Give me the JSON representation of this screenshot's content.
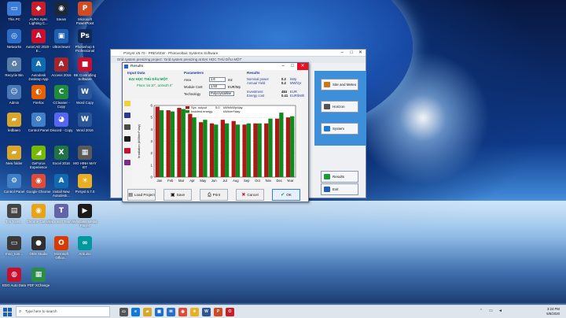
{
  "desktop": {
    "icons": [
      {
        "label": "This PC",
        "glyph": "▭",
        "color": "#3b7dd8"
      },
      {
        "label": "AURA Sync Lighting C...",
        "glyph": "◆",
        "color": "#c81e2a"
      },
      {
        "label": "Steam",
        "glyph": "◉",
        "color": "#1b2838"
      },
      {
        "label": "Microsoft PowerPoint",
        "glyph": "P",
        "color": "#d04a22"
      },
      {
        "label": "Networks",
        "glyph": "◎",
        "color": "#2b6cc8"
      },
      {
        "label": "AutoCAD 2020 - E...",
        "glyph": "A",
        "color": "#c8102e"
      },
      {
        "label": "UltraViewer",
        "glyph": "▣",
        "color": "#1f5fb0"
      },
      {
        "label": "Photoshop 5 Professional",
        "glyph": "Ps",
        "color": "#102a55"
      },
      {
        "label": "Recycle Bin",
        "glyph": "♻",
        "color": "#5a7da8"
      },
      {
        "label": "Autodesk Desktop App",
        "glyph": "A",
        "color": "#0f6ab0"
      },
      {
        "label": "Access 2016",
        "glyph": "A",
        "color": "#a4262c"
      },
      {
        "label": "BK Controlling Software",
        "glyph": "■",
        "color": "#c8102e"
      },
      {
        "label": "Admin",
        "glyph": "☺",
        "color": "#4a78b8"
      },
      {
        "label": "Firefox",
        "glyph": "◐",
        "color": "#e66000"
      },
      {
        "label": "CCleaner - Copy",
        "glyph": "C",
        "color": "#1e8c3a"
      },
      {
        "label": "Word Copy",
        "glyph": "W",
        "color": "#2b579a"
      },
      {
        "label": "ledbaeo",
        "glyph": "▰",
        "color": "#d8a62a"
      },
      {
        "label": "Control Panel",
        "glyph": "⚙",
        "color": "#3f7fc8"
      },
      {
        "label": "Discord - Copy",
        "glyph": "◕",
        "color": "#5865f2"
      },
      {
        "label": "Word 2016",
        "glyph": "W",
        "color": "#2b579a"
      },
      {
        "label": "New folder",
        "glyph": "▰",
        "color": "#d8a62a"
      },
      {
        "label": "GeForce Experience",
        "glyph": "◢",
        "color": "#76b900"
      },
      {
        "label": "Excel 2016",
        "glyph": "X",
        "color": "#217346"
      },
      {
        "label": "MO HINH MAY ĐT",
        "glyph": "▦",
        "color": "#5a5a5a"
      },
      {
        "label": "Control Panel",
        "glyph": "⚙",
        "color": "#3f7fc8"
      },
      {
        "label": "Google Chrome",
        "glyph": "◉",
        "color": "#dd4b39"
      },
      {
        "label": "Install New Autodesk...",
        "glyph": "A",
        "color": "#0f6ab0"
      },
      {
        "label": "PVsyst 6.7.0",
        "glyph": "☀",
        "color": "#e8b020"
      },
      {
        "label": "Toll Tools...",
        "glyph": "▤",
        "color": "#444"
      },
      {
        "label": "Chrome Canary",
        "glyph": "◉",
        "color": "#e8a317"
      },
      {
        "label": "Microsoft Teams",
        "glyph": "T",
        "color": "#6264a7"
      },
      {
        "label": "Windows Media Player",
        "glyph": "▶",
        "color": "#1a1a1a"
      },
      {
        "label": "moo_tom...",
        "glyph": "▭",
        "color": "#3a3a3a"
      },
      {
        "label": "OBS Studio",
        "glyph": "●",
        "color": "#302e31"
      },
      {
        "label": "Microsoft Office...",
        "glyph": "O",
        "color": "#d83b01"
      },
      {
        "label": "Arduino",
        "glyph": "∞",
        "color": "#00979d"
      },
      {
        "label": "EDG Auto Data",
        "glyph": "◍",
        "color": "#c8102e"
      },
      {
        "label": "PDF XChange",
        "glyph": "▦",
        "color": "#2a8c4a"
      }
    ]
  },
  "main_window": {
    "title": "PVsyst V6.70 - PREVIEW - Photovoltaic Systems Software",
    "subtitle": "Grid system presizing project: 'Grid system presizing  at ĐẠI HỌC THỦ DẦU MỘT'",
    "side_buttons": [
      {
        "label": "Site and Meteo",
        "icon_color": "#c87a1a"
      },
      {
        "label": "Horizon",
        "icon_color": "#555"
      },
      {
        "label": "System",
        "icon_color": "#1e7ad0"
      },
      {
        "label": "Results",
        "icon_color": "#1a9a3a"
      },
      {
        "label": "Exit",
        "icon_color": "#1e5fb8"
      }
    ]
  },
  "dialog": {
    "title": "Results",
    "input_data": {
      "heading": "Input Data",
      "project_name": "ĐẠI HỌC THỦ DẦU MỘT",
      "place": "Place: lat 10°, azimuth 0°"
    },
    "parameters": {
      "heading": "Parameters",
      "rows": [
        {
          "label": "Area",
          "value": "1.6",
          "unit": "m2"
        },
        {
          "label": "Module Cost",
          "value": "1.50",
          "unit": "EUR/Wp"
        },
        {
          "label": "Technology",
          "value": "Polycrystalline",
          "unit": ""
        }
      ]
    },
    "results": {
      "heading": "Results",
      "rows": [
        {
          "label": "Nominal power",
          "value": "0.2",
          "unit": "kWp"
        },
        {
          "label": "Annual Yield",
          "value": "0.2",
          "unit": "MWh/yr"
        },
        {
          "label": "Investment",
          "value": "484",
          "unit": "EUR"
        },
        {
          "label": "Energy cost",
          "value": "0.41",
          "unit": "EUR/kWh"
        }
      ]
    },
    "buttons": [
      {
        "label": "Load Project",
        "icon": "▤"
      },
      {
        "label": "Save",
        "icon": "▣"
      },
      {
        "label": "Print",
        "icon": "⎙"
      },
      {
        "label": "Cancel",
        "icon": "✖"
      },
      {
        "label": "OK",
        "icon": "✔"
      }
    ]
  },
  "chart_data": {
    "type": "bar",
    "categories": [
      "Jan",
      "Feb",
      "Mar",
      "Apr",
      "May",
      "Jun",
      "Jul",
      "Aug",
      "Sep",
      "Oct",
      "Nov",
      "Dec",
      "Year"
    ],
    "series": [
      {
        "name": "Sys. output",
        "color": "#b01818",
        "values": [
          5.9,
          5.6,
          5.8,
          5.3,
          4.6,
          4.5,
          4.8,
          4.7,
          4.4,
          4.5,
          4.5,
          4.9,
          5.0
        ]
      },
      {
        "name": "Incident energy",
        "color": "#0e8a1e",
        "values": [
          5.6,
          5.5,
          5.7,
          5.0,
          4.8,
          4.4,
          4.5,
          4.4,
          4.5,
          4.5,
          4.9,
          5.4,
          5.1
        ]
      }
    ],
    "legend": [
      {
        "label": "Sys. output",
        "value": "5.0",
        "unit": "kWh/kWp/day"
      },
      {
        "label": "Incident energy",
        "value": "",
        "unit": "kWh/m²/day"
      }
    ],
    "ylabel": "Irradiation (kWh/m²·day)",
    "ylim": [
      0,
      6
    ],
    "yticks": [
      "0",
      "1",
      "2",
      "3",
      "4",
      "5",
      "6"
    ],
    "grid": true,
    "legend_position": "top-center"
  },
  "taskbar": {
    "search_placeholder": "Type here to search",
    "apps": [
      {
        "name": "task-view",
        "glyph": "▭",
        "color": "#555"
      },
      {
        "name": "edge",
        "glyph": "e",
        "color": "#0f7ad8"
      },
      {
        "name": "file-explorer",
        "glyph": "▰",
        "color": "#d8a62a"
      },
      {
        "name": "store",
        "glyph": "▦",
        "color": "#1e6fd0"
      },
      {
        "name": "mail",
        "glyph": "✉",
        "color": "#2a6fc8"
      },
      {
        "name": "chrome",
        "glyph": "◉",
        "color": "#dd4b39"
      },
      {
        "name": "pvsyst",
        "glyph": "☀",
        "color": "#e8b020"
      },
      {
        "name": "word",
        "glyph": "W",
        "color": "#2b579a"
      },
      {
        "name": "powerpoint",
        "glyph": "P",
        "color": "#d04a22"
      },
      {
        "name": "opera",
        "glyph": "O",
        "color": "#c81e2a"
      }
    ],
    "time": "3:24 PM",
    "date": "5/8/2020"
  }
}
